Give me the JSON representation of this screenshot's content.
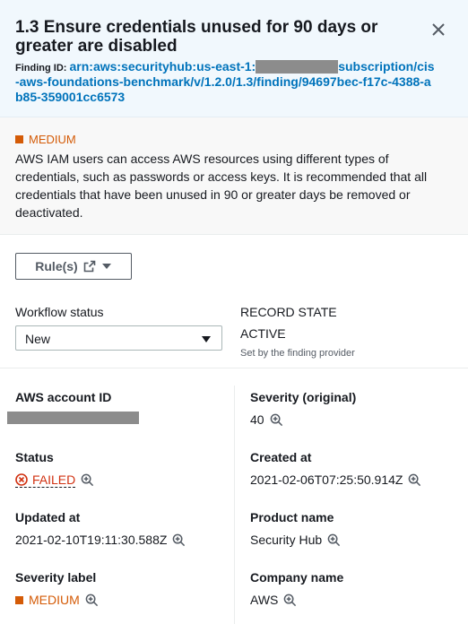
{
  "header": {
    "title": "1.3 Ensure credentials unused for 90 days or greater are disabled",
    "finding_id_label": "Finding ID:",
    "finding_id_prefix": "arn:aws:securityhub:us-east-1:",
    "finding_id_suffix": "subscription/cis-aws-foundations-benchmark/v/1.2.0/1.3/finding/94697bec-f17c-4388-ab85-359001cc6573"
  },
  "description": {
    "severity": "MEDIUM",
    "text": "AWS IAM users can access AWS resources using different types of credentials, such as passwords or access keys. It is recommended that all credentials that have been unused in 90 or greater days be removed or deactivated."
  },
  "rules_button": {
    "label": "Rule(s)"
  },
  "workflow": {
    "label": "Workflow status",
    "selected": "New"
  },
  "record_state": {
    "label": "RECORD STATE",
    "value": "ACTIVE",
    "note": "Set by the finding provider"
  },
  "details": {
    "account_id_label": "AWS account ID",
    "severity_original_label": "Severity (original)",
    "severity_original_value": "40",
    "status_label": "Status",
    "status_value": "FAILED",
    "created_label": "Created at",
    "created_value": "2021-02-06T07:25:50.914Z",
    "updated_label": "Updated at",
    "updated_value": "2021-02-10T19:11:30.588Z",
    "product_label": "Product name",
    "product_value": "Security Hub",
    "severity_label_label": "Severity label",
    "severity_label_value": "MEDIUM",
    "company_label": "Company name",
    "company_value": "AWS"
  },
  "colors": {
    "header_bg": "#f1f8fd",
    "link": "#0073bb",
    "medium": "#d45b07",
    "failed": "#d13212"
  }
}
